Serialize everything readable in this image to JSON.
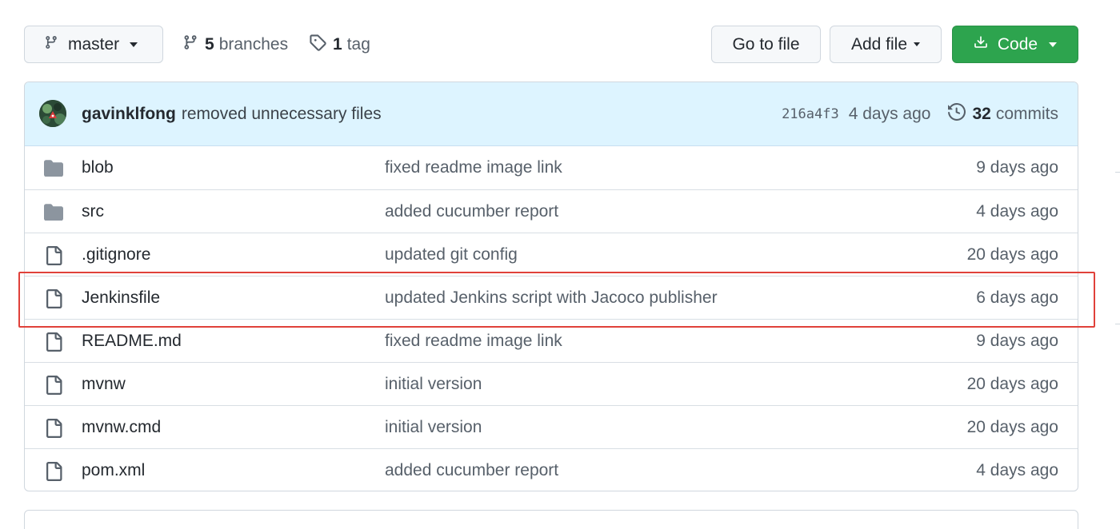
{
  "toolbar": {
    "branch": "master",
    "branches_count": "5",
    "branches_label": "branches",
    "tags_count": "1",
    "tags_label": "tag",
    "goto_label": "Go to file",
    "addfile_label": "Add file",
    "code_label": "Code"
  },
  "commit": {
    "author": "gavinklfong",
    "message": "removed unnecessary files",
    "sha": "216a4f3",
    "age": "4 days ago",
    "commits_count": "32",
    "commits_label": "commits"
  },
  "files": [
    {
      "name": "blob",
      "type": "folder",
      "message": "fixed readme image link",
      "age": "9 days ago"
    },
    {
      "name": "src",
      "type": "folder",
      "message": "added cucumber report",
      "age": "4 days ago"
    },
    {
      "name": ".gitignore",
      "type": "file",
      "message": "updated git config",
      "age": "20 days ago"
    },
    {
      "name": "Jenkinsfile",
      "type": "file",
      "message": "updated Jenkins script with Jacoco publisher",
      "age": "6 days ago"
    },
    {
      "name": "README.md",
      "type": "file",
      "message": "fixed readme image link",
      "age": "9 days ago"
    },
    {
      "name": "mvnw",
      "type": "file",
      "message": "initial version",
      "age": "20 days ago"
    },
    {
      "name": "mvnw.cmd",
      "type": "file",
      "message": "initial version",
      "age": "20 days ago"
    },
    {
      "name": "pom.xml",
      "type": "file",
      "message": "added cucumber report",
      "age": "4 days ago"
    }
  ],
  "colors": {
    "code_button": "#2da44e",
    "commit_header_bg": "#ddf4ff",
    "highlight_border": "#e0413a"
  }
}
